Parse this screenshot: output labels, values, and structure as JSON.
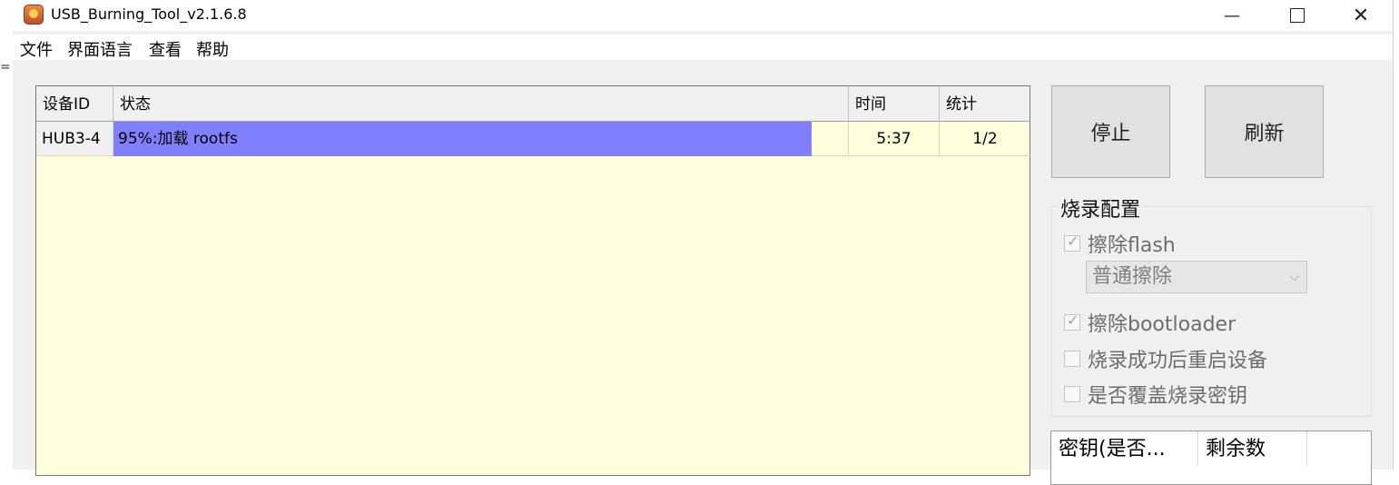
{
  "window": {
    "title": "USB_Burning_Tool_v2.1.6.8"
  },
  "menu": {
    "items": [
      "文件",
      "界面语言",
      "查看",
      "帮助"
    ]
  },
  "device_table": {
    "columns": [
      "设备ID",
      "状态",
      "时间",
      "统计"
    ],
    "rows": [
      {
        "id": "HUB3-4",
        "status": "95%:加载 rootfs",
        "progress": 0.95,
        "time": "5:37",
        "count": "1/2"
      }
    ]
  },
  "buttons": {
    "stop": "停止",
    "refresh": "刷新"
  },
  "burn_config": {
    "label": "烧录配置",
    "erase_flash": {
      "label": "擦除flash",
      "checked": true
    },
    "erase_mode": {
      "value": "普通擦除"
    },
    "erase_bootloader": {
      "label": "擦除bootloader",
      "checked": true
    },
    "reboot_after": {
      "label": "烧录成功后重启设备",
      "checked": false
    },
    "overwrite_key": {
      "label": "是否覆盖烧录密钥",
      "checked": false
    }
  },
  "key_table": {
    "columns": [
      "密钥(是否...",
      "剩余数"
    ]
  },
  "colors": {
    "list_bg": "#ffffdc",
    "progress": "#8080ff",
    "panel": "#f0f0f0"
  },
  "icons": {
    "app": "app-icon",
    "minimize": "minimize-icon",
    "maximize": "maximize-icon",
    "close": "close-icon"
  }
}
